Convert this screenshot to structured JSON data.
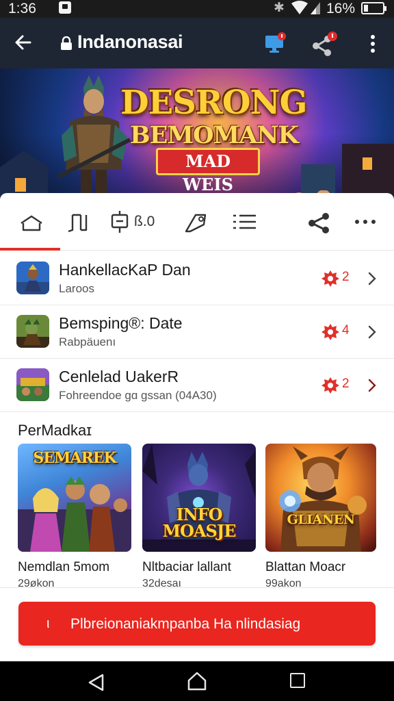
{
  "status_bar": {
    "time": "1:36",
    "battery_percent": "16%",
    "icons": [
      "notification-icon",
      "bluetooth-icon",
      "wifi-icon",
      "signal-icon",
      "battery-icon"
    ]
  },
  "app_bar": {
    "title": "Indanonasai",
    "icons": [
      "back-arrow-icon",
      "lock-icon",
      "cast-icon",
      "share-icon",
      "more-vert-icon"
    ]
  },
  "banner": {
    "line1": "DESRONG",
    "line2": "BEMOMANK",
    "line3": "MAD WEIS"
  },
  "tabs": {
    "rating_value": "ß.0",
    "icons": [
      "home-icon",
      "book-icon",
      "rating-icon",
      "tag-icon",
      "list-icon",
      "share-icon",
      "more-horiz-icon"
    ],
    "active_index": 0
  },
  "list": {
    "items": [
      {
        "name": "HankellacKaP Dan",
        "sub": "Laroos",
        "count": "2"
      },
      {
        "name": "Bemsping®: Date",
        "sub": "Rabpäuenı",
        "count": "4"
      },
      {
        "name": "Cenlelad UakerR",
        "sub": "Fohreendoe gɑ gssan (04A30)",
        "count": "2"
      }
    ]
  },
  "section": {
    "title": "PerMadkaɪ",
    "cards": [
      {
        "name": "Nemdlan 5mom",
        "sub": "29økon",
        "art_text": "SEMAREK"
      },
      {
        "name": "Nltbaciar lallant",
        "sub": "32desaı",
        "art_text": "INFO MOASJE"
      },
      {
        "name": "Blattan Moacr",
        "sub": "99akon",
        "art_text": "GLIANEN"
      }
    ]
  },
  "cta": {
    "label": "Plbreionaniakmpanba Ha nlindasiag",
    "dot": "ι"
  },
  "colors": {
    "accent": "#e9261f",
    "app_bar": "#1e2633",
    "status_bar": "#1b1b1b"
  }
}
